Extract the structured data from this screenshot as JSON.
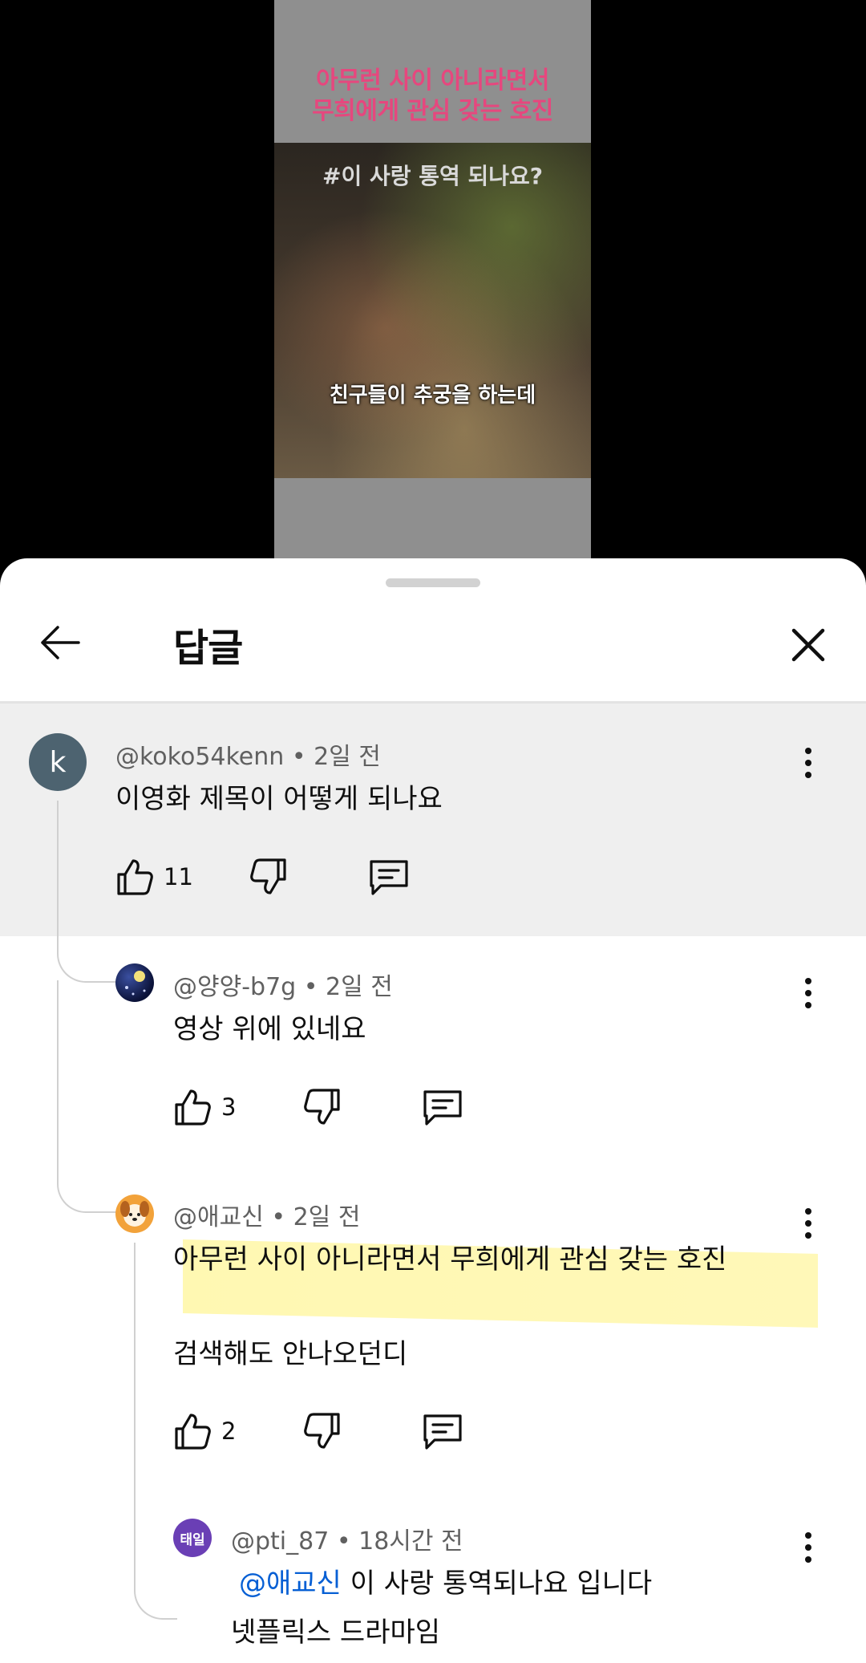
{
  "video": {
    "title_line1": "아무런 사이 아니라면서",
    "title_line2": "무희에게 관심 갖는 호진",
    "hashtag": "#이 사랑 통역 되나요?",
    "subtitle": "친구들이 추궁을 하는데"
  },
  "header": {
    "title": "답글",
    "back_icon": "arrow-left-icon",
    "close_icon": "close-icon"
  },
  "parent_comment": {
    "avatar_letter": "k",
    "author": "@koko54kenn",
    "time": "2일 전",
    "text": "이영화 제목이 어떻게 되나요",
    "likes": "11"
  },
  "replies": [
    {
      "author": "@양양-b7g",
      "time": "2일 전",
      "lines": [
        "영상 위에 있네요"
      ],
      "likes": "3"
    },
    {
      "author": "@애교신",
      "time": "2일 전",
      "lines": [
        "아무런 사이 아니라면서 무희에게 관심 갖는 호진",
        "검색해도 안나오던디"
      ],
      "likes": "2"
    },
    {
      "avatar_text": "태일",
      "author": "@pti_87",
      "time": "18시간 전",
      "mention": "@애교신",
      "line1_rest": " 이 사랑 통역되나요 입니다",
      "line2": "넷플릭스 드라마임"
    }
  ],
  "separator": " • ",
  "colors": {
    "mention": "#065fd4",
    "highlight": "#fff6a8",
    "parent_bg": "#efefef"
  }
}
